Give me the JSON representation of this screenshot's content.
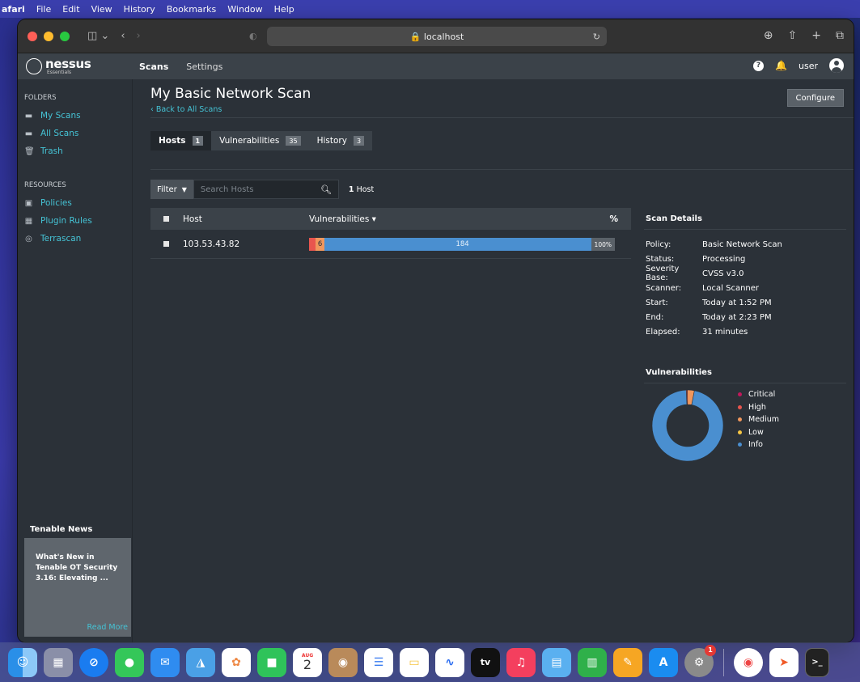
{
  "menubar": {
    "items": [
      "afari",
      "File",
      "Edit",
      "View",
      "History",
      "Bookmarks",
      "Window",
      "Help"
    ]
  },
  "browser": {
    "url": "localhost"
  },
  "nav": {
    "logo_text": "nessus",
    "logo_sub": "Essentials",
    "scans": "Scans",
    "settings": "Settings",
    "user": "user"
  },
  "sidebar": {
    "folders_heading": "FOLDERS",
    "folders": [
      {
        "label": "My Scans",
        "icon": "folder-icon"
      },
      {
        "label": "All Scans",
        "icon": "folder-icon"
      },
      {
        "label": "Trash",
        "icon": "trash-icon"
      }
    ],
    "resources_heading": "RESOURCES",
    "resources": [
      {
        "label": "Policies",
        "icon": "policy-icon"
      },
      {
        "label": "Plugin Rules",
        "icon": "plugin-rules-icon"
      },
      {
        "label": "Terrascan",
        "icon": "terrascan-icon"
      }
    ],
    "news_title": "Tenable News",
    "news_body": "What's New in Tenable OT Security 3.16: Elevating ...",
    "news_more": "Read More",
    "collapse": "«"
  },
  "main": {
    "title": "My Basic Network Scan",
    "back": "‹ Back to All Scans",
    "configure": "Configure",
    "tabs": [
      {
        "label": "Hosts",
        "count": "1"
      },
      {
        "label": "Vulnerabilities",
        "count": "35"
      },
      {
        "label": "History",
        "count": "3"
      }
    ],
    "filter": "Filter",
    "search_placeholder": "Search Hosts",
    "host_count_num": "1",
    "host_count_label": "Host",
    "table": {
      "col_host": "Host",
      "col_vuln": "Vulnerabilities ▾",
      "col_pct": "%",
      "rows": [
        {
          "host": "103.53.43.82",
          "medium": "6",
          "info": "184",
          "pct": "100%"
        }
      ]
    }
  },
  "details": {
    "title": "Scan Details",
    "rows": [
      {
        "k": "Policy:",
        "v": "Basic Network Scan"
      },
      {
        "k": "Status:",
        "v": "Processing"
      },
      {
        "k": "Severity Base:",
        "v": "CVSS v3.0"
      },
      {
        "k": "Scanner:",
        "v": "Local Scanner"
      },
      {
        "k": "Start:",
        "v": "Today at 1:52 PM"
      },
      {
        "k": "End:",
        "v": "Today at 2:23 PM"
      },
      {
        "k": "Elapsed:",
        "v": "31 minutes"
      }
    ],
    "vuln_title": "Vulnerabilities",
    "legend": [
      {
        "label": "Critical",
        "color": "#c2185b"
      },
      {
        "label": "High",
        "color": "#e8554e"
      },
      {
        "label": "Medium",
        "color": "#f0975d"
      },
      {
        "label": "Low",
        "color": "#f7c744"
      },
      {
        "label": "Info",
        "color": "#4a8fd0"
      }
    ]
  },
  "chart_data": {
    "type": "pie",
    "categories": [
      "Critical",
      "High",
      "Medium",
      "Low",
      "Info"
    ],
    "values": [
      0,
      1,
      6,
      0,
      184
    ]
  },
  "dock": {
    "calendar_month": "AUG",
    "calendar_day": "2",
    "settings_badge": "1",
    "tv_label": "tv"
  }
}
